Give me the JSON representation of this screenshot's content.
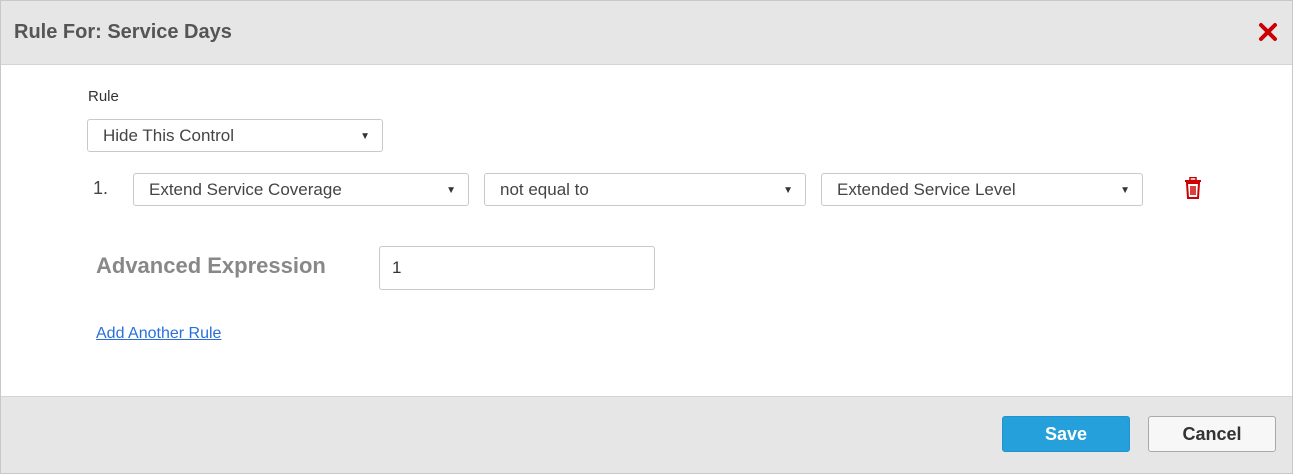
{
  "dialog": {
    "title": "Rule For: Service Days",
    "close_icon": "close-icon",
    "accent_color": "#cc0000"
  },
  "form": {
    "rule_label": "Rule",
    "rule_select_value": "Hide This Control",
    "conditions": [
      {
        "number": "1.",
        "field": "Extend Service Coverage",
        "operator": "not equal to",
        "value": "Extended Service Level",
        "delete_icon": "trash-icon"
      }
    ],
    "advanced_expression_label": "Advanced Expression",
    "advanced_expression_value": "1",
    "add_rule_link": "Add Another Rule"
  },
  "footer": {
    "save_label": "Save",
    "cancel_label": "Cancel",
    "save_color": "#26a0da"
  },
  "dropdown_arrow": "▼"
}
